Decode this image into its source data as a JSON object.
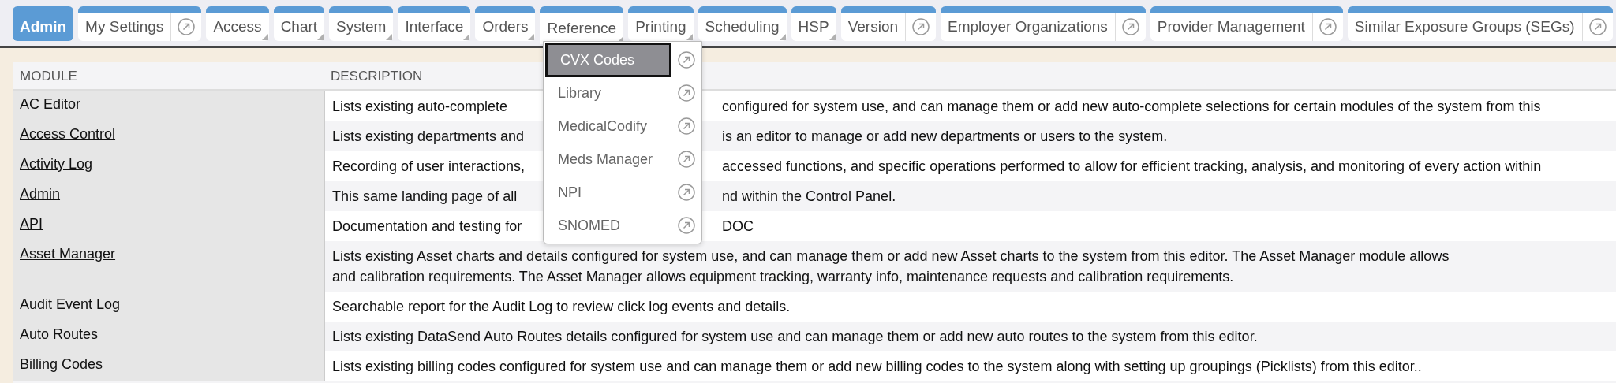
{
  "tabs": [
    {
      "label": "Admin",
      "kind": "plain",
      "selected": true,
      "open": false
    },
    {
      "label": "My Settings",
      "kind": "link",
      "selected": false,
      "open": false
    },
    {
      "label": "Access",
      "kind": "menu",
      "selected": false,
      "open": false
    },
    {
      "label": "Chart",
      "kind": "menu",
      "selected": false,
      "open": false
    },
    {
      "label": "System",
      "kind": "menu",
      "selected": false,
      "open": false
    },
    {
      "label": "Interface",
      "kind": "menu",
      "selected": false,
      "open": false
    },
    {
      "label": "Orders",
      "kind": "menu",
      "selected": false,
      "open": false
    },
    {
      "label": "Reference",
      "kind": "menu",
      "selected": false,
      "open": true
    },
    {
      "label": "Printing",
      "kind": "menu",
      "selected": false,
      "open": false
    },
    {
      "label": "Scheduling",
      "kind": "menu",
      "selected": false,
      "open": false
    },
    {
      "label": "HSP",
      "kind": "menu",
      "selected": false,
      "open": false
    },
    {
      "label": "Version",
      "kind": "link",
      "selected": false,
      "open": false
    },
    {
      "label": "Employer Organizations",
      "kind": "link",
      "selected": false,
      "open": false
    },
    {
      "label": "Provider Management",
      "kind": "link",
      "selected": false,
      "open": false
    },
    {
      "label": "Similar Exposure Groups (SEGs)",
      "kind": "link",
      "selected": false,
      "open": false
    }
  ],
  "dropdown": {
    "items": [
      {
        "label": "CVX Codes",
        "selected": true
      },
      {
        "label": "Library",
        "selected": false
      },
      {
        "label": "MedicalCodify",
        "selected": false
      },
      {
        "label": "Meds Manager",
        "selected": false
      },
      {
        "label": "NPI",
        "selected": false
      },
      {
        "label": "SNOMED",
        "selected": false
      }
    ]
  },
  "table": {
    "columns": [
      "MODULE",
      "DESCRIPTION"
    ],
    "rows": [
      {
        "module": "AC Editor",
        "description": [
          "Lists existing auto-complete",
          "configured for system use, and can manage them or add new auto-complete selections for certain modules of the system from this"
        ]
      },
      {
        "module": "Access Control",
        "description": [
          "Lists existing departments and",
          "is an editor to manage or add new departments or users to the system."
        ]
      },
      {
        "module": "Activity Log",
        "description": [
          "Recording of user interactions,",
          "accessed functions, and specific operations performed to allow for efficient tracking, analysis, and monitoring of every action within"
        ]
      },
      {
        "module": "Admin",
        "description": [
          "This same landing page of all",
          "nd within the Control Panel."
        ]
      },
      {
        "module": "API",
        "description": [
          "Documentation and testing for",
          "DOC"
        ]
      },
      {
        "module": "Asset Manager",
        "lines": [
          "Lists existing Asset charts and details configured for system use, and can manage them or add new Asset charts to the system from this editor. The Asset Manager module allows",
          "and calibration requirements. The Asset Manager allows equipment tracking, warranty info, maintenance requests and calibration requirements."
        ]
      },
      {
        "module": "Audit Event Log",
        "lines": [
          "Searchable report for the Audit Log to review click log events and details."
        ]
      },
      {
        "module": "Auto Routes",
        "lines": [
          "Lists existing DataSend Auto Routes details configured for system use and can manage them or add new auto routes to the system from this editor."
        ]
      },
      {
        "module": "Billing Codes",
        "lines": [
          "Lists existing billing codes configured for system use and can manage them or add new billing codes to the system along with setting up groupings (Picklists) from this editor.."
        ]
      }
    ]
  }
}
